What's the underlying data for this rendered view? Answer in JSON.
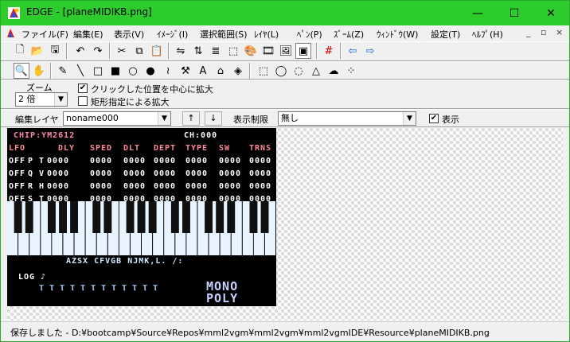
{
  "window": {
    "title": "EDGE - [planeMIDIKB.png]"
  },
  "window_buttons": {
    "minimize": "—",
    "maximize": "☐",
    "close": "✕"
  },
  "menu": {
    "items": [
      "ファイル(F)",
      "編集(E)",
      "表示(V)",
      "ｲﾒｰｼﾞ(I)",
      "選択範囲(S)",
      "ﾚｲﾔ(L)",
      "ﾍﾟﾝ(P)",
      "ｽﾞｰﾑ(Z)",
      "ｳｨﾝﾄﾞｳ(W)",
      "設定(T)",
      "ﾍﾙﾌﾟ(H)"
    ],
    "mdi": [
      "_",
      "▫",
      "×"
    ]
  },
  "zoom": {
    "group_label": "ズーム",
    "value": "2 倍",
    "opt1": "クリックした位置を中心に拡大",
    "opt1_checked": true,
    "opt2": "矩形指定による拡大",
    "opt2_checked": false
  },
  "layer": {
    "label": "編集レイヤ",
    "value": "noname000",
    "up": "↑",
    "down": "↓",
    "limit_label": "表示制限",
    "limit_value": "無し",
    "show_label": "表示",
    "show_checked": true
  },
  "status": {
    "text": "保存しました - D:¥bootcamp¥Source¥Repos¥mml2vgm¥mml2vgm¥mml2vgmIDE¥Resource¥planeMIDIKB.png"
  },
  "image": {
    "chip": "CHIP:YM2612",
    "ch": "CH:000",
    "header": [
      "LFO",
      "DLY",
      "SPED",
      "DLT",
      "DEPT",
      "TYPE",
      "SW",
      "TRNS"
    ],
    "rows": [
      [
        "OFF",
        "P",
        "T",
        "0000",
        "0000",
        "0000",
        "0000",
        "0000",
        "0000",
        "0000"
      ],
      [
        "OFF",
        "Q",
        "V",
        "0000",
        "0000",
        "0000",
        "0000",
        "0000",
        "0000",
        "0000"
      ],
      [
        "OFF",
        "R",
        "H",
        "0000",
        "0000",
        "0000",
        "0000",
        "0000",
        "0000",
        "0000"
      ],
      [
        "OFF",
        "S",
        "T",
        "0000",
        "0000",
        "0000",
        "0000",
        "0000",
        "0000",
        "0000"
      ]
    ],
    "keys": "AZSX CFVGB NJMK,L. /:",
    "log": "LOG ♪",
    "logo1": "MONO",
    "logo2": "POLY"
  }
}
